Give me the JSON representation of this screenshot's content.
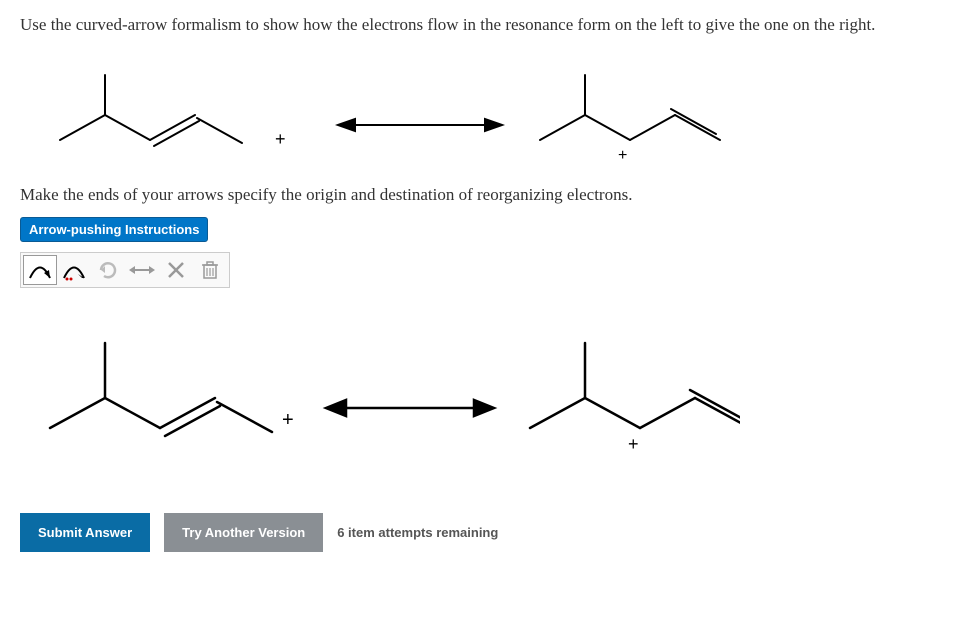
{
  "question": {
    "line1": "Use the curved-arrow formalism to show how the electrons flow in the resonance form on the left to give the one on the right.",
    "line2": "Make the ends of your arrows specify the origin and destination of reorganizing electrons."
  },
  "instructions_button": "Arrow-pushing Instructions",
  "toolbar": {
    "tool_full_arrow": "full-arrow",
    "tool_half_arrow": "half-arrow",
    "tool_rotate": "rotate",
    "tool_resonance": "resonance-arrow",
    "tool_delete": "delete",
    "tool_trash": "trash"
  },
  "footer": {
    "submit": "Submit Answer",
    "try_another": "Try Another Version",
    "attempts": "6 item attempts remaining"
  }
}
